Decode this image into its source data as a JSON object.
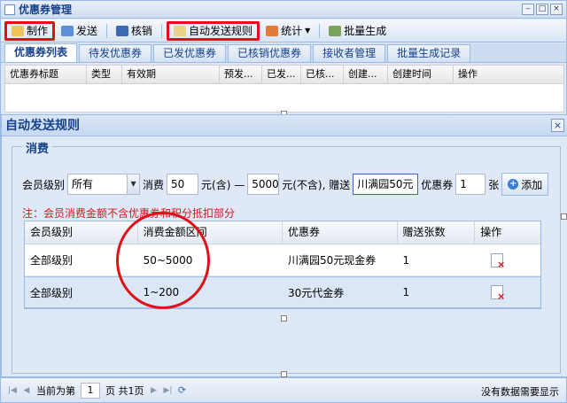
{
  "window": {
    "title": "优惠券管理",
    "controls": [
      "‒",
      "□",
      "×"
    ]
  },
  "toolbar": {
    "make": "制作",
    "send": "发送",
    "verify": "核销",
    "auto_rule": "自动发送规则",
    "stats": "统计",
    "batch": "批量生成"
  },
  "tabs": [
    "优惠券列表",
    "待发优惠券",
    "已发优惠券",
    "已核销优惠券",
    "接收者管理",
    "批量生成记录"
  ],
  "list_columns": [
    "优惠券标题",
    "类型",
    "有效期",
    "预发...",
    "已发...",
    "已核...",
    "创建...",
    "创建时间",
    "操作"
  ],
  "dialog": {
    "title": "自动发送规则",
    "close": "×",
    "legend": "消费",
    "member_level_label": "会员级别",
    "member_level_value": "所有",
    "consume_label": "消费",
    "min_value": "50",
    "min_unit": "元(含) —",
    "max_value": "5000",
    "max_unit": "元(不含), 赠送",
    "coupon_value": "川满园50元",
    "coupon_label": "优惠券",
    "count_value": "1",
    "count_unit": "张",
    "add_button": "添加",
    "note": "注：会员消费金额不含优惠券和积分抵扣部分",
    "columns": [
      "会员级别",
      "消费金额区间",
      "优惠券",
      "赠送张数",
      "操作"
    ],
    "rows": [
      {
        "level": "全部级别",
        "range": "50~5000",
        "coupon": "川满园50元现金券",
        "count": "1"
      },
      {
        "level": "全部级别",
        "range": "1~200",
        "coupon": "30元代金券",
        "count": "1"
      }
    ]
  },
  "paging": {
    "prefix": "当前为第",
    "page": "1",
    "suffix": "页 共1页",
    "status": "没有数据需要显示"
  },
  "colors": {
    "highlight": "#e0101a",
    "accent": "#15428b",
    "border": "#99bbe8"
  }
}
